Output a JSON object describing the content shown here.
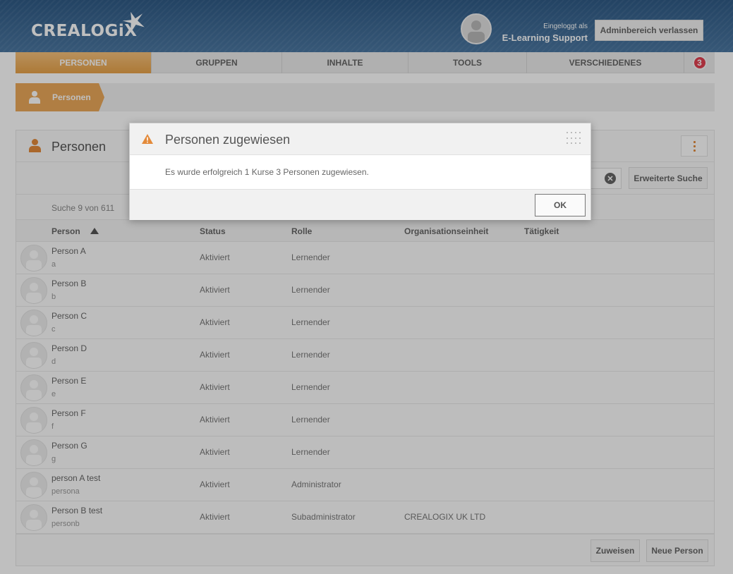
{
  "header": {
    "logo_text": "CREALOGiX",
    "logged_in_label": "Eingeloggt als",
    "user_name": "E-Learning Support",
    "exit_admin_label": "Adminbereich verlassen"
  },
  "nav": {
    "items": [
      {
        "label": "PERSONEN",
        "active": true
      },
      {
        "label": "GRUPPEN",
        "active": false
      },
      {
        "label": "INHALTE",
        "active": false
      },
      {
        "label": "TOOLS",
        "active": false
      },
      {
        "label": "VERSCHIEDENES",
        "active": false
      }
    ],
    "notification_count": "3"
  },
  "breadcrumb": {
    "items": [
      {
        "label": "Personen",
        "icon": "person-icon"
      }
    ]
  },
  "panel": {
    "title": "Personen",
    "search_value": "",
    "advanced_search_label": "Erweiterte Suche",
    "search_count": "Suche 9 von 611",
    "columns": [
      "Person",
      "Status",
      "Rolle",
      "Organisationseinheit",
      "Tätigkeit"
    ],
    "rows": [
      {
        "name": "Person A",
        "login": "a",
        "status": "Aktiviert",
        "role": "Lernender",
        "org": "",
        "activity": ""
      },
      {
        "name": "Person B",
        "login": "b",
        "status": "Aktiviert",
        "role": "Lernender",
        "org": "",
        "activity": ""
      },
      {
        "name": "Person C",
        "login": "c",
        "status": "Aktiviert",
        "role": "Lernender",
        "org": "",
        "activity": ""
      },
      {
        "name": "Person D",
        "login": "d",
        "status": "Aktiviert",
        "role": "Lernender",
        "org": "",
        "activity": ""
      },
      {
        "name": "Person E",
        "login": "e",
        "status": "Aktiviert",
        "role": "Lernender",
        "org": "",
        "activity": ""
      },
      {
        "name": "Person F",
        "login": "f",
        "status": "Aktiviert",
        "role": "Lernender",
        "org": "",
        "activity": ""
      },
      {
        "name": "Person G",
        "login": "g",
        "status": "Aktiviert",
        "role": "Lernender",
        "org": "",
        "activity": ""
      },
      {
        "name": "person A test",
        "login": "persona",
        "status": "Aktiviert",
        "role": "Administrator",
        "org": "",
        "activity": ""
      },
      {
        "name": "Person B test",
        "login": "personb",
        "status": "Aktiviert",
        "role": "Subadministrator",
        "org": "CREALOGIX UK LTD",
        "activity": ""
      }
    ],
    "assign_label": "Zuweisen",
    "new_person_label": "Neue Person"
  },
  "dialog": {
    "title": "Personen zugewiesen",
    "message": "Es wurde erfolgreich 1 Kurse 3 Personen zugewiesen.",
    "ok_label": "OK",
    "icon": "warning-icon"
  },
  "colors": {
    "header_blue": "#3a6690",
    "accent_orange": "#e38a3a",
    "badge_red": "#e04050"
  }
}
